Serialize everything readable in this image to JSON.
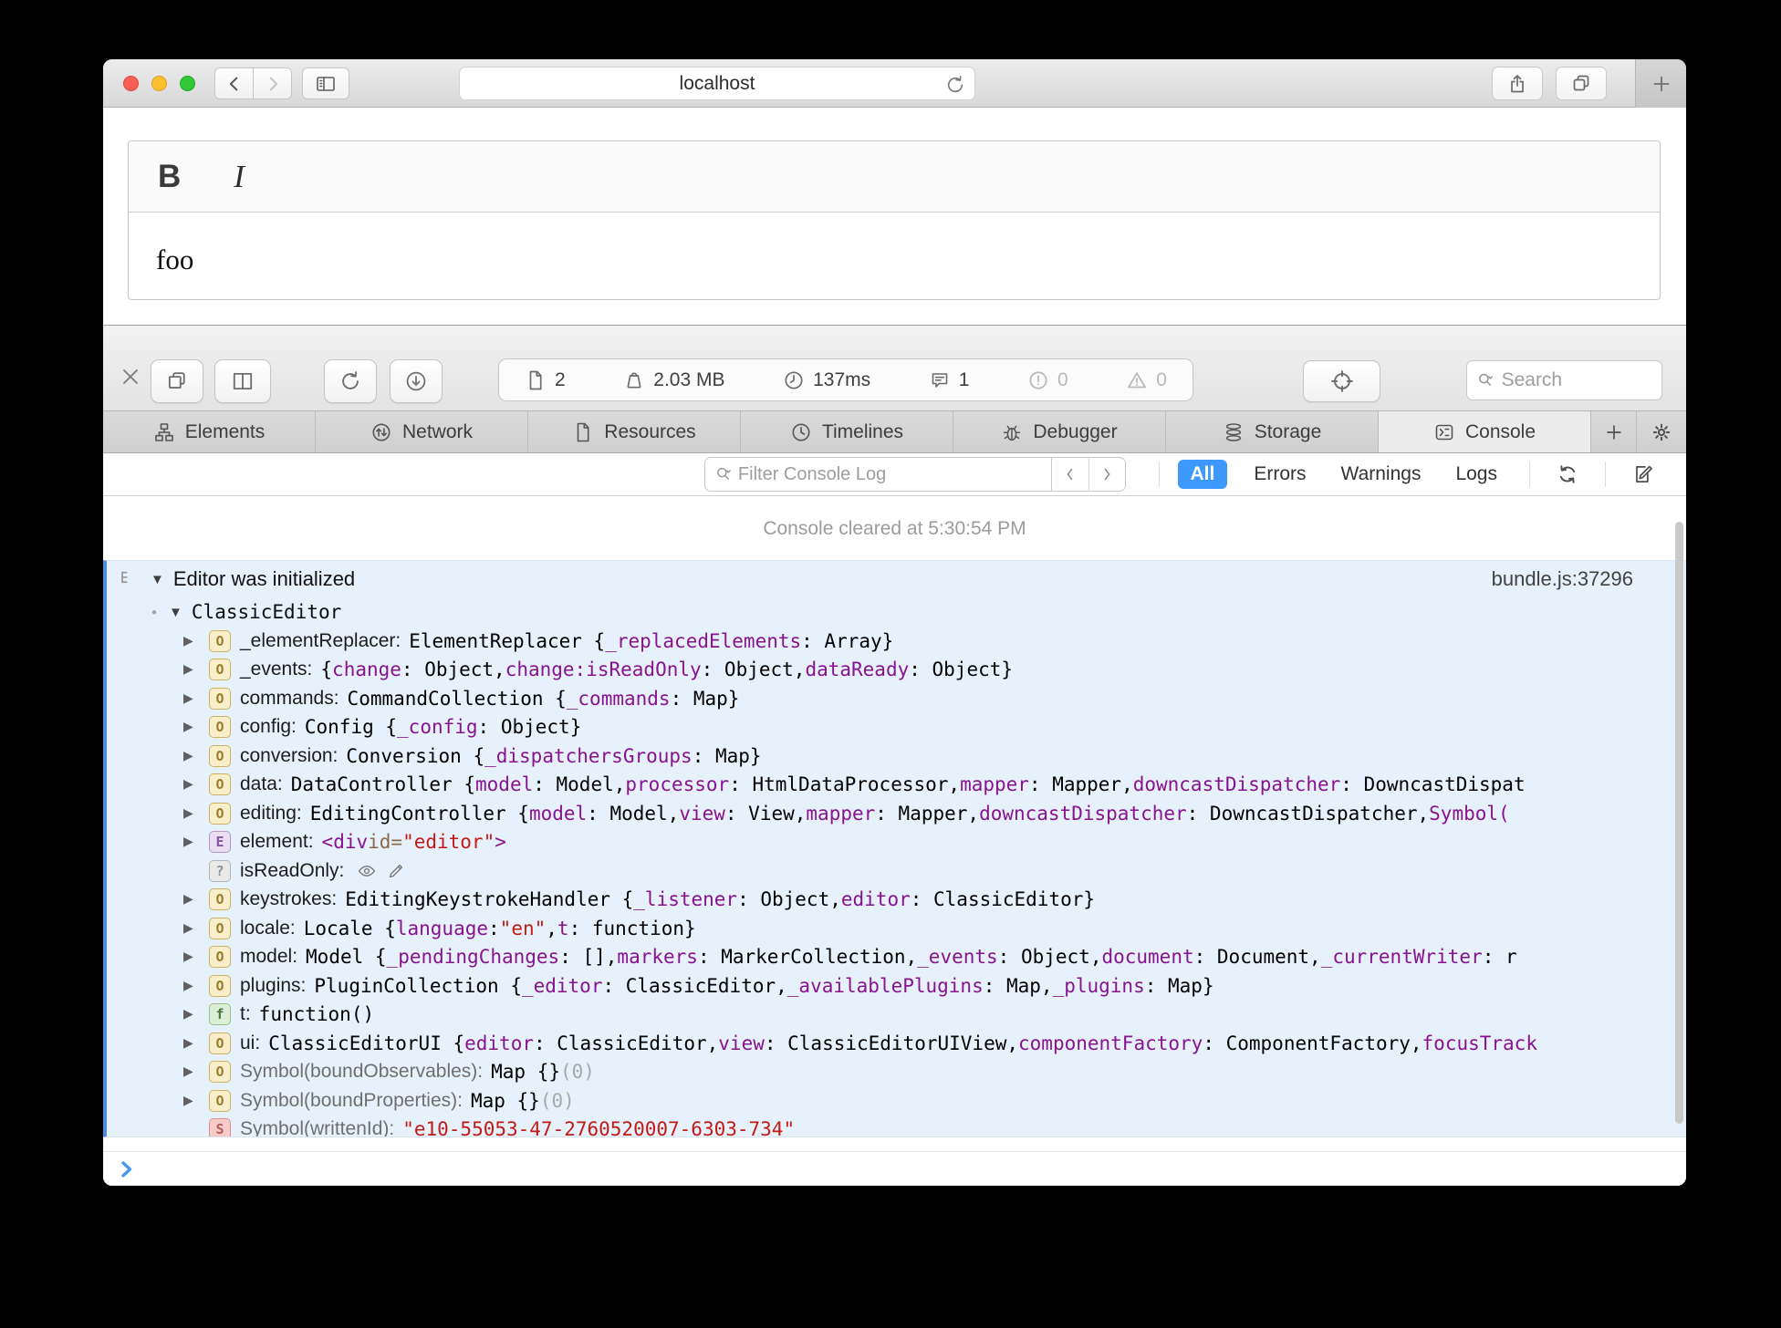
{
  "colors": {
    "accent_blue": "#3d99fc",
    "log_row_bg": "#e7f1fb",
    "log_stripe": "#4a90e2",
    "key_purple": "#881391",
    "string_red": "#c41a16"
  },
  "window": {
    "url": "localhost"
  },
  "page": {
    "editor_toolbar": {
      "bold_label": "B",
      "italic_label": "I"
    },
    "editor_content": "foo"
  },
  "inspector": {
    "stats": {
      "documents": {
        "icon": "document-icon",
        "value": "2"
      },
      "size": {
        "icon": "weight-icon",
        "value": "2.03 MB"
      },
      "time": {
        "icon": "clock-icon",
        "value": "137ms"
      },
      "messages": {
        "icon": "message-bubble-icon",
        "value": "1"
      },
      "errors": {
        "icon": "error-icon",
        "value": "0"
      },
      "warnings": {
        "icon": "warning-icon",
        "value": "0"
      }
    },
    "search": {
      "placeholder": "Search"
    },
    "tabs": [
      {
        "id": "elements",
        "label": "Elements",
        "icon": "elements-icon",
        "active": false
      },
      {
        "id": "network",
        "label": "Network",
        "icon": "network-icon",
        "active": false
      },
      {
        "id": "resources",
        "label": "Resources",
        "icon": "resources-icon",
        "active": false
      },
      {
        "id": "timelines",
        "label": "Timelines",
        "icon": "timelines-icon",
        "active": false
      },
      {
        "id": "debugger",
        "label": "Debugger",
        "icon": "debugger-icon",
        "active": false
      },
      {
        "id": "storage",
        "label": "Storage",
        "icon": "storage-icon",
        "active": false
      },
      {
        "id": "console",
        "label": "Console",
        "icon": "console-icon",
        "active": true
      }
    ],
    "filter": {
      "placeholder": "Filter Console Log",
      "scopes": [
        "All",
        "Errors",
        "Warnings",
        "Logs"
      ],
      "active_scope": "All"
    },
    "console": {
      "cleared_message": "Console cleared at 5:30:54 PM",
      "log_title": "Editor was initialized",
      "log_source": "bundle.js:37296",
      "root_label": "ClassicEditor",
      "rows": [
        {
          "badge": "O",
          "expand": true,
          "name": "_elementReplacer",
          "segments": [
            [
              "p",
              "ElementReplacer {"
            ],
            [
              "k",
              "_replacedElements"
            ],
            [
              "p",
              ": Array}"
            ]
          ]
        },
        {
          "badge": "O",
          "expand": true,
          "name": "_events",
          "segments": [
            [
              "p",
              "{"
            ],
            [
              "k",
              "change"
            ],
            [
              "p",
              ": Object, "
            ],
            [
              "k",
              "change:isReadOnly"
            ],
            [
              "p",
              ": Object, "
            ],
            [
              "k",
              "dataReady"
            ],
            [
              "p",
              ": Object}"
            ]
          ]
        },
        {
          "badge": "O",
          "expand": true,
          "name": "commands",
          "segments": [
            [
              "p",
              "CommandCollection {"
            ],
            [
              "k",
              "_commands"
            ],
            [
              "p",
              ": Map}"
            ]
          ]
        },
        {
          "badge": "O",
          "expand": true,
          "name": "config",
          "segments": [
            [
              "p",
              "Config {"
            ],
            [
              "k",
              "_config"
            ],
            [
              "p",
              ": Object}"
            ]
          ]
        },
        {
          "badge": "O",
          "expand": true,
          "name": "conversion",
          "segments": [
            [
              "p",
              "Conversion {"
            ],
            [
              "k",
              "_dispatchersGroups"
            ],
            [
              "p",
              ": Map}"
            ]
          ]
        },
        {
          "badge": "O",
          "expand": true,
          "name": "data",
          "segments": [
            [
              "p",
              "DataController {"
            ],
            [
              "k",
              "model"
            ],
            [
              "p",
              ": Model, "
            ],
            [
              "k",
              "processor"
            ],
            [
              "p",
              ": HtmlDataProcessor, "
            ],
            [
              "k",
              "mapper"
            ],
            [
              "p",
              ": Mapper, "
            ],
            [
              "k",
              "downcastDispatcher"
            ],
            [
              "p",
              ": DowncastDispat"
            ]
          ]
        },
        {
          "badge": "O",
          "expand": true,
          "name": "editing",
          "segments": [
            [
              "p",
              "EditingController {"
            ],
            [
              "k",
              "model"
            ],
            [
              "p",
              ": Model, "
            ],
            [
              "k",
              "view"
            ],
            [
              "p",
              ": View, "
            ],
            [
              "k",
              "mapper"
            ],
            [
              "p",
              ": Mapper, "
            ],
            [
              "k",
              "downcastDispatcher"
            ],
            [
              "p",
              ": DowncastDispatcher, "
            ],
            [
              "k",
              "Symbol("
            ]
          ]
        },
        {
          "badge": "E",
          "expand": true,
          "name": "element",
          "segments": [
            [
              "tag",
              "<div "
            ],
            [
              "attr",
              "id="
            ],
            [
              "val",
              "\"editor\""
            ],
            [
              "tag",
              ">"
            ]
          ]
        },
        {
          "badge": "?",
          "expand": false,
          "name": "isReadOnly",
          "segments": [
            [
              "icon",
              "getter-eye-icon"
            ],
            [
              "icon",
              "setter-pencil-icon"
            ]
          ]
        },
        {
          "badge": "O",
          "expand": true,
          "name": "keystrokes",
          "segments": [
            [
              "p",
              "EditingKeystrokeHandler {"
            ],
            [
              "k",
              "_listener"
            ],
            [
              "p",
              ": Object, "
            ],
            [
              "k",
              "editor"
            ],
            [
              "p",
              ": ClassicEditor}"
            ]
          ]
        },
        {
          "badge": "O",
          "expand": true,
          "name": "locale",
          "segments": [
            [
              "p",
              "Locale {"
            ],
            [
              "k",
              "language"
            ],
            [
              "p",
              ": "
            ],
            [
              "s",
              "\"en\""
            ],
            [
              "p",
              ", "
            ],
            [
              "k",
              "t"
            ],
            [
              "p",
              ": function}"
            ]
          ]
        },
        {
          "badge": "O",
          "expand": true,
          "name": "model",
          "segments": [
            [
              "p",
              "Model {"
            ],
            [
              "k",
              "_pendingChanges"
            ],
            [
              "p",
              ": [], "
            ],
            [
              "k",
              "markers"
            ],
            [
              "p",
              ": MarkerCollection, "
            ],
            [
              "k",
              "_events"
            ],
            [
              "p",
              ": Object, "
            ],
            [
              "k",
              "document"
            ],
            [
              "p",
              ": Document, "
            ],
            [
              "k",
              "_currentWriter"
            ],
            [
              "p",
              ": r"
            ]
          ]
        },
        {
          "badge": "O",
          "expand": true,
          "name": "plugins",
          "segments": [
            [
              "p",
              "PluginCollection {"
            ],
            [
              "k",
              "_editor"
            ],
            [
              "p",
              ": ClassicEditor, "
            ],
            [
              "k",
              "_availablePlugins"
            ],
            [
              "p",
              ": Map, "
            ],
            [
              "k",
              "_plugins"
            ],
            [
              "p",
              ": Map}"
            ]
          ]
        },
        {
          "badge": "f",
          "expand": true,
          "name": "t",
          "segments": [
            [
              "p",
              "function()"
            ]
          ]
        },
        {
          "badge": "O",
          "expand": true,
          "name": "ui",
          "segments": [
            [
              "p",
              "ClassicEditorUI {"
            ],
            [
              "k",
              "editor"
            ],
            [
              "p",
              ": ClassicEditor, "
            ],
            [
              "k",
              "view"
            ],
            [
              "p",
              ": ClassicEditorUIView, "
            ],
            [
              "k",
              "componentFactory"
            ],
            [
              "p",
              ": ComponentFactory, "
            ],
            [
              "k",
              "focusTrack"
            ]
          ]
        },
        {
          "badge": "O",
          "expand": true,
          "name": "Symbol(boundObservables)",
          "gray": true,
          "segments": [
            [
              "p",
              "Map {} "
            ],
            [
              "lg",
              "(0)"
            ]
          ]
        },
        {
          "badge": "O",
          "expand": true,
          "name": "Symbol(boundProperties)",
          "gray": true,
          "segments": [
            [
              "p",
              "Map {} "
            ],
            [
              "lg",
              "(0)"
            ]
          ]
        },
        {
          "badge": "S",
          "expand": false,
          "name": "Symbol(writtenId)",
          "gray": true,
          "segments": [
            [
              "s",
              "\"e10-55053-47-2760520007-6303-734\""
            ]
          ]
        }
      ]
    }
  }
}
